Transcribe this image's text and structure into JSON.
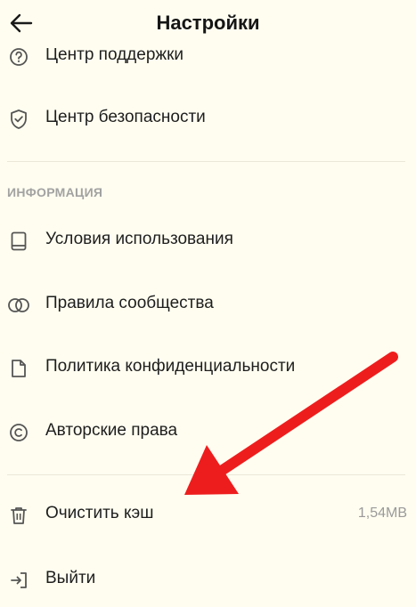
{
  "header": {
    "title": "Настройки"
  },
  "menu": {
    "support": "Центр поддержки",
    "safety": "Центр безопасности",
    "section_info": "ИНФОРМАЦИЯ",
    "terms": "Условия использования",
    "community": "Правила сообщества",
    "privacy": "Политика конфиденциальности",
    "copyright": "Авторские права",
    "clear_cache": "Очистить кэш",
    "cache_size": "1,54MB",
    "logout": "Выйти"
  },
  "colors": {
    "background": "#fffdf0",
    "arrow": "#ee1d1d",
    "section_title": "#a2a2a2"
  },
  "icons": {
    "back": "arrow-left-icon",
    "support": "help-circle-icon",
    "safety": "shield-check-icon",
    "terms": "book-icon",
    "community": "overlapping-circles-icon",
    "privacy": "document-icon",
    "copyright": "copyright-icon",
    "clear_cache": "trash-icon",
    "logout": "logout-icon"
  }
}
